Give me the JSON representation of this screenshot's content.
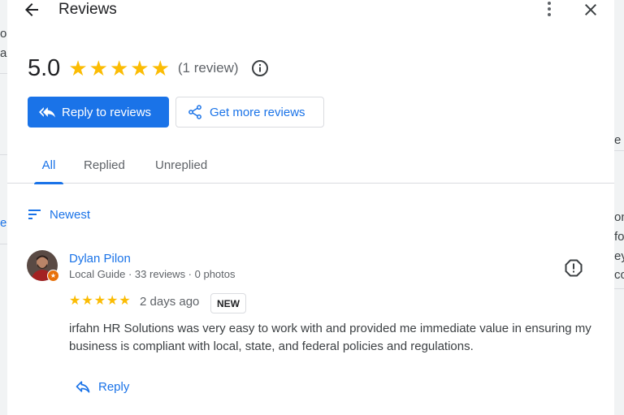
{
  "header": {
    "title": "Reviews"
  },
  "summary": {
    "rating": "5.0",
    "stars": 5,
    "review_count": "(1 review)"
  },
  "actions": {
    "reply_label": "Reply to reviews",
    "get_more_label": "Get more reviews"
  },
  "tabs": [
    {
      "label": "All",
      "active": true
    },
    {
      "label": "Replied",
      "active": false
    },
    {
      "label": "Unreplied",
      "active": false
    }
  ],
  "sort": {
    "label": "Newest"
  },
  "reviews": [
    {
      "name": "Dylan Pilon",
      "meta": "Local Guide · 33 reviews · 0 photos",
      "stars": 5,
      "date": "2 days ago",
      "badge": "NEW",
      "text": "irfahn HR Solutions was very easy to work with and provided me immediate value in ensuring my business is compliant with local, state, and federal policies and regulations.",
      "reply_label": "Reply"
    }
  ],
  "colors": {
    "accent": "#1a73e8",
    "star": "#fbbc04",
    "text_primary": "#202124",
    "text_secondary": "#5f6368"
  },
  "background_fragments": {
    "left": [
      "o",
      "ar",
      "el"
    ],
    "right": [
      "e n",
      "on",
      "fo",
      "ey",
      "co"
    ]
  }
}
